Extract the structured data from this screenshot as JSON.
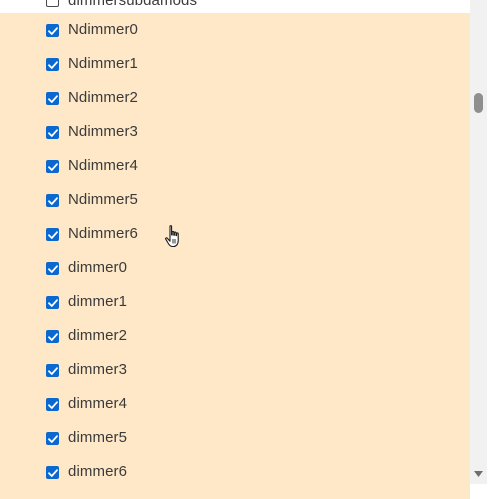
{
  "list": {
    "partial_top_item": {
      "label": "dimmersubdamods",
      "checked": false
    },
    "items": [
      {
        "label": "Ndimmer0",
        "checked": true
      },
      {
        "label": "Ndimmer1",
        "checked": true
      },
      {
        "label": "Ndimmer2",
        "checked": true
      },
      {
        "label": "Ndimmer3",
        "checked": true
      },
      {
        "label": "Ndimmer4",
        "checked": true
      },
      {
        "label": "Ndimmer5",
        "checked": true
      },
      {
        "label": "Ndimmer6",
        "checked": true
      },
      {
        "label": "dimmer0",
        "checked": true
      },
      {
        "label": "dimmer1",
        "checked": true
      },
      {
        "label": "dimmer2",
        "checked": true
      },
      {
        "label": "dimmer3",
        "checked": true
      },
      {
        "label": "dimmer4",
        "checked": true
      },
      {
        "label": "dimmer5",
        "checked": true
      },
      {
        "label": "dimmer6",
        "checked": true
      }
    ]
  },
  "colors": {
    "selected_background": "#ffe8c8",
    "checkbox_checked": "#0b68cf",
    "label_text": "#3a3a3a",
    "scrollbar_track": "#f1f1f1",
    "scrollbar_thumb": "#8f8f8f"
  },
  "icons": {
    "checkbox_checked": "checkmark-icon",
    "scroll_down": "triangle-down-icon",
    "cursor": "hand-pointer-icon"
  }
}
